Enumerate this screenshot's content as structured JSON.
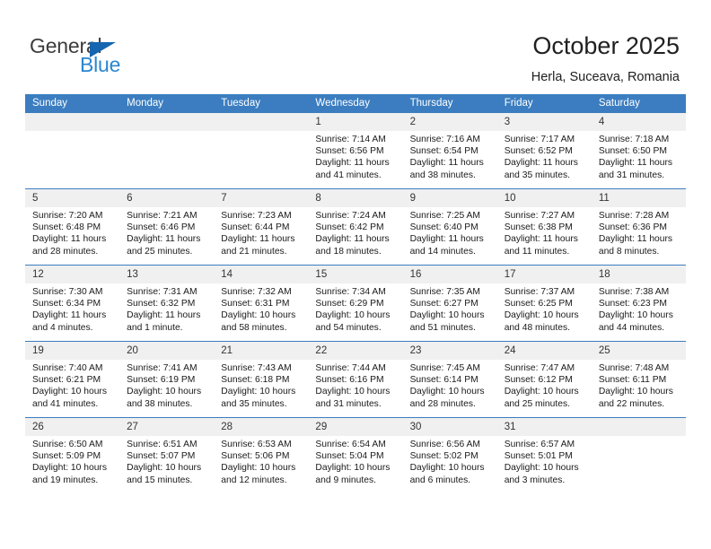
{
  "brand": {
    "name_part1": "General",
    "name_part2": "Blue",
    "triangle_color": "#1565b0",
    "blue_color": "#2b86d0"
  },
  "header": {
    "title": "October 2025",
    "location": "Herla, Suceava, Romania"
  },
  "theme": {
    "header_blue": "#3b7dc0",
    "daynum_band": "#f0f0f0"
  },
  "weekday_headers": [
    "Sunday",
    "Monday",
    "Tuesday",
    "Wednesday",
    "Thursday",
    "Friday",
    "Saturday"
  ],
  "weeks": [
    [
      {
        "day": "",
        "empty": true,
        "sunrise": "",
        "sunset": "",
        "daylight_line1": "",
        "daylight_line2": ""
      },
      {
        "day": "",
        "empty": true,
        "sunrise": "",
        "sunset": "",
        "daylight_line1": "",
        "daylight_line2": ""
      },
      {
        "day": "",
        "empty": true,
        "sunrise": "",
        "sunset": "",
        "daylight_line1": "",
        "daylight_line2": ""
      },
      {
        "day": "1",
        "empty": false,
        "sunrise": "Sunrise: 7:14 AM",
        "sunset": "Sunset: 6:56 PM",
        "daylight_line1": "Daylight: 11 hours",
        "daylight_line2": "and 41 minutes."
      },
      {
        "day": "2",
        "empty": false,
        "sunrise": "Sunrise: 7:16 AM",
        "sunset": "Sunset: 6:54 PM",
        "daylight_line1": "Daylight: 11 hours",
        "daylight_line2": "and 38 minutes."
      },
      {
        "day": "3",
        "empty": false,
        "sunrise": "Sunrise: 7:17 AM",
        "sunset": "Sunset: 6:52 PM",
        "daylight_line1": "Daylight: 11 hours",
        "daylight_line2": "and 35 minutes."
      },
      {
        "day": "4",
        "empty": false,
        "sunrise": "Sunrise: 7:18 AM",
        "sunset": "Sunset: 6:50 PM",
        "daylight_line1": "Daylight: 11 hours",
        "daylight_line2": "and 31 minutes."
      }
    ],
    [
      {
        "day": "5",
        "empty": false,
        "sunrise": "Sunrise: 7:20 AM",
        "sunset": "Sunset: 6:48 PM",
        "daylight_line1": "Daylight: 11 hours",
        "daylight_line2": "and 28 minutes."
      },
      {
        "day": "6",
        "empty": false,
        "sunrise": "Sunrise: 7:21 AM",
        "sunset": "Sunset: 6:46 PM",
        "daylight_line1": "Daylight: 11 hours",
        "daylight_line2": "and 25 minutes."
      },
      {
        "day": "7",
        "empty": false,
        "sunrise": "Sunrise: 7:23 AM",
        "sunset": "Sunset: 6:44 PM",
        "daylight_line1": "Daylight: 11 hours",
        "daylight_line2": "and 21 minutes."
      },
      {
        "day": "8",
        "empty": false,
        "sunrise": "Sunrise: 7:24 AM",
        "sunset": "Sunset: 6:42 PM",
        "daylight_line1": "Daylight: 11 hours",
        "daylight_line2": "and 18 minutes."
      },
      {
        "day": "9",
        "empty": false,
        "sunrise": "Sunrise: 7:25 AM",
        "sunset": "Sunset: 6:40 PM",
        "daylight_line1": "Daylight: 11 hours",
        "daylight_line2": "and 14 minutes."
      },
      {
        "day": "10",
        "empty": false,
        "sunrise": "Sunrise: 7:27 AM",
        "sunset": "Sunset: 6:38 PM",
        "daylight_line1": "Daylight: 11 hours",
        "daylight_line2": "and 11 minutes."
      },
      {
        "day": "11",
        "empty": false,
        "sunrise": "Sunrise: 7:28 AM",
        "sunset": "Sunset: 6:36 PM",
        "daylight_line1": "Daylight: 11 hours",
        "daylight_line2": "and 8 minutes."
      }
    ],
    [
      {
        "day": "12",
        "empty": false,
        "sunrise": "Sunrise: 7:30 AM",
        "sunset": "Sunset: 6:34 PM",
        "daylight_line1": "Daylight: 11 hours",
        "daylight_line2": "and 4 minutes."
      },
      {
        "day": "13",
        "empty": false,
        "sunrise": "Sunrise: 7:31 AM",
        "sunset": "Sunset: 6:32 PM",
        "daylight_line1": "Daylight: 11 hours",
        "daylight_line2": "and 1 minute."
      },
      {
        "day": "14",
        "empty": false,
        "sunrise": "Sunrise: 7:32 AM",
        "sunset": "Sunset: 6:31 PM",
        "daylight_line1": "Daylight: 10 hours",
        "daylight_line2": "and 58 minutes."
      },
      {
        "day": "15",
        "empty": false,
        "sunrise": "Sunrise: 7:34 AM",
        "sunset": "Sunset: 6:29 PM",
        "daylight_line1": "Daylight: 10 hours",
        "daylight_line2": "and 54 minutes."
      },
      {
        "day": "16",
        "empty": false,
        "sunrise": "Sunrise: 7:35 AM",
        "sunset": "Sunset: 6:27 PM",
        "daylight_line1": "Daylight: 10 hours",
        "daylight_line2": "and 51 minutes."
      },
      {
        "day": "17",
        "empty": false,
        "sunrise": "Sunrise: 7:37 AM",
        "sunset": "Sunset: 6:25 PM",
        "daylight_line1": "Daylight: 10 hours",
        "daylight_line2": "and 48 minutes."
      },
      {
        "day": "18",
        "empty": false,
        "sunrise": "Sunrise: 7:38 AM",
        "sunset": "Sunset: 6:23 PM",
        "daylight_line1": "Daylight: 10 hours",
        "daylight_line2": "and 44 minutes."
      }
    ],
    [
      {
        "day": "19",
        "empty": false,
        "sunrise": "Sunrise: 7:40 AM",
        "sunset": "Sunset: 6:21 PM",
        "daylight_line1": "Daylight: 10 hours",
        "daylight_line2": "and 41 minutes."
      },
      {
        "day": "20",
        "empty": false,
        "sunrise": "Sunrise: 7:41 AM",
        "sunset": "Sunset: 6:19 PM",
        "daylight_line1": "Daylight: 10 hours",
        "daylight_line2": "and 38 minutes."
      },
      {
        "day": "21",
        "empty": false,
        "sunrise": "Sunrise: 7:43 AM",
        "sunset": "Sunset: 6:18 PM",
        "daylight_line1": "Daylight: 10 hours",
        "daylight_line2": "and 35 minutes."
      },
      {
        "day": "22",
        "empty": false,
        "sunrise": "Sunrise: 7:44 AM",
        "sunset": "Sunset: 6:16 PM",
        "daylight_line1": "Daylight: 10 hours",
        "daylight_line2": "and 31 minutes."
      },
      {
        "day": "23",
        "empty": false,
        "sunrise": "Sunrise: 7:45 AM",
        "sunset": "Sunset: 6:14 PM",
        "daylight_line1": "Daylight: 10 hours",
        "daylight_line2": "and 28 minutes."
      },
      {
        "day": "24",
        "empty": false,
        "sunrise": "Sunrise: 7:47 AM",
        "sunset": "Sunset: 6:12 PM",
        "daylight_line1": "Daylight: 10 hours",
        "daylight_line2": "and 25 minutes."
      },
      {
        "day": "25",
        "empty": false,
        "sunrise": "Sunrise: 7:48 AM",
        "sunset": "Sunset: 6:11 PM",
        "daylight_line1": "Daylight: 10 hours",
        "daylight_line2": "and 22 minutes."
      }
    ],
    [
      {
        "day": "26",
        "empty": false,
        "sunrise": "Sunrise: 6:50 AM",
        "sunset": "Sunset: 5:09 PM",
        "daylight_line1": "Daylight: 10 hours",
        "daylight_line2": "and 19 minutes."
      },
      {
        "day": "27",
        "empty": false,
        "sunrise": "Sunrise: 6:51 AM",
        "sunset": "Sunset: 5:07 PM",
        "daylight_line1": "Daylight: 10 hours",
        "daylight_line2": "and 15 minutes."
      },
      {
        "day": "28",
        "empty": false,
        "sunrise": "Sunrise: 6:53 AM",
        "sunset": "Sunset: 5:06 PM",
        "daylight_line1": "Daylight: 10 hours",
        "daylight_line2": "and 12 minutes."
      },
      {
        "day": "29",
        "empty": false,
        "sunrise": "Sunrise: 6:54 AM",
        "sunset": "Sunset: 5:04 PM",
        "daylight_line1": "Daylight: 10 hours",
        "daylight_line2": "and 9 minutes."
      },
      {
        "day": "30",
        "empty": false,
        "sunrise": "Sunrise: 6:56 AM",
        "sunset": "Sunset: 5:02 PM",
        "daylight_line1": "Daylight: 10 hours",
        "daylight_line2": "and 6 minutes."
      },
      {
        "day": "31",
        "empty": false,
        "sunrise": "Sunrise: 6:57 AM",
        "sunset": "Sunset: 5:01 PM",
        "daylight_line1": "Daylight: 10 hours",
        "daylight_line2": "and 3 minutes."
      },
      {
        "day": "",
        "empty": true,
        "sunrise": "",
        "sunset": "",
        "daylight_line1": "",
        "daylight_line2": ""
      }
    ]
  ]
}
